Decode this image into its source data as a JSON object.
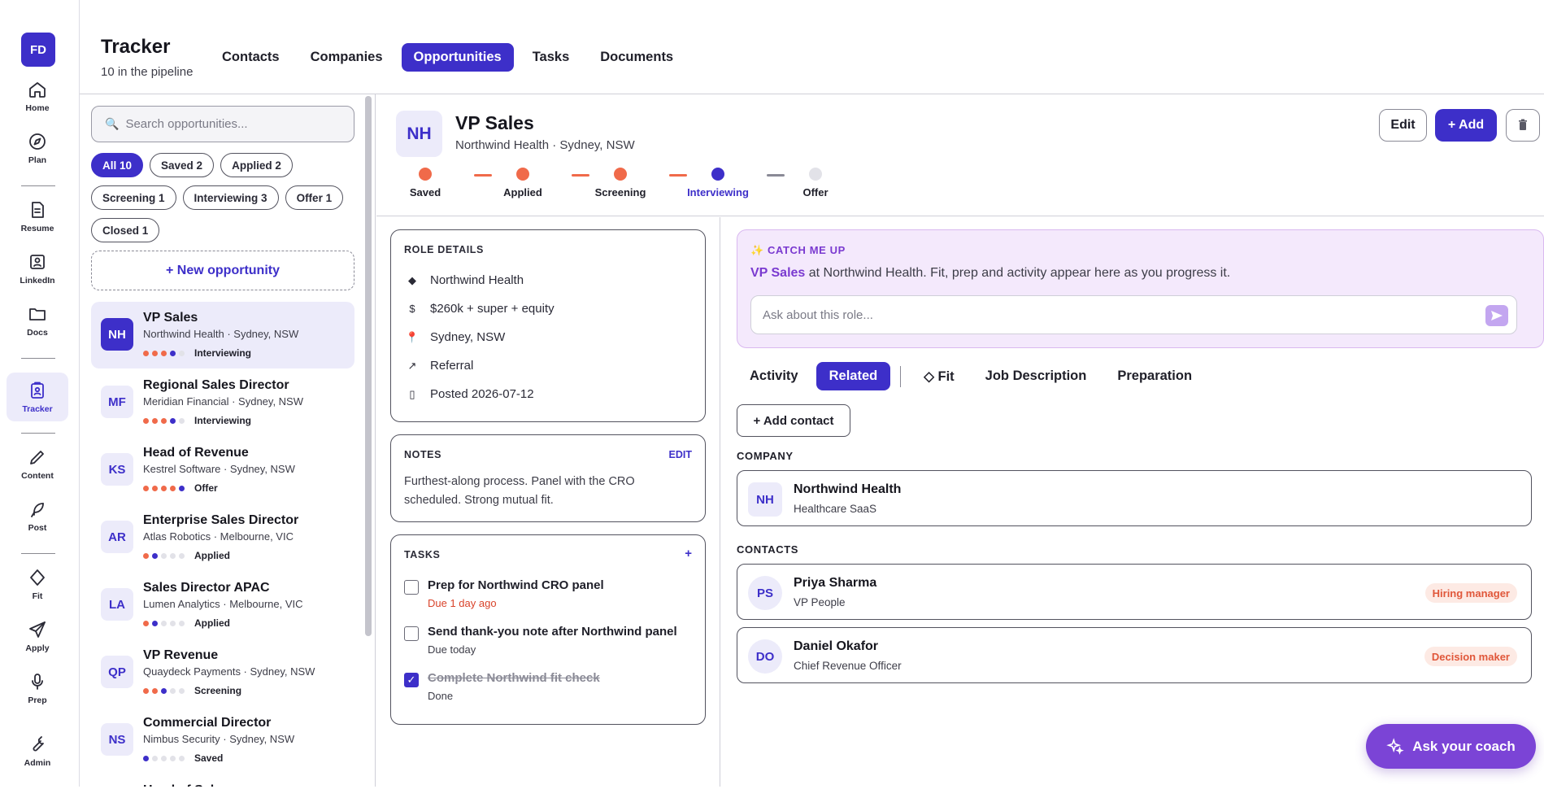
{
  "user": {
    "initials": "FD"
  },
  "nav": [
    {
      "label": "Home",
      "icon": "home-icon"
    },
    {
      "label": "Plan",
      "icon": "compass-icon"
    },
    {
      "label": "Resume",
      "icon": "document-icon"
    },
    {
      "label": "LinkedIn",
      "icon": "profile-card-icon"
    },
    {
      "label": "Docs",
      "icon": "folder-icon"
    },
    {
      "label": "Tracker",
      "icon": "tracker-icon"
    },
    {
      "label": "Content",
      "icon": "pen-icon"
    },
    {
      "label": "Post",
      "icon": "feather-icon"
    },
    {
      "label": "Fit",
      "icon": "diamond-icon"
    },
    {
      "label": "Apply",
      "icon": "send-icon"
    },
    {
      "label": "Prep",
      "icon": "microphone-icon"
    },
    {
      "label": "Admin",
      "icon": "wrench-icon"
    }
  ],
  "header": {
    "title": "Tracker",
    "subtitle": "10 in the pipeline",
    "tabs": [
      "Contacts",
      "Companies",
      "Opportunities",
      "Tasks",
      "Documents"
    ],
    "active_tab": "Opportunities"
  },
  "list": {
    "search_placeholder": "Search opportunities...",
    "filters": [
      "All 10",
      "Saved 2",
      "Applied 2",
      "Screening 1",
      "Interviewing 3",
      "Offer 1",
      "Closed 1"
    ],
    "new_label": "+ New opportunity",
    "items": [
      {
        "initials": "NH",
        "title": "VP Sales",
        "sub": "Northwind Health · Sydney, NSW",
        "stage": "Interviewing",
        "progress": 4
      },
      {
        "initials": "MF",
        "title": "Regional Sales Director",
        "sub": "Meridian Financial · Sydney, NSW",
        "stage": "Interviewing",
        "progress": 4
      },
      {
        "initials": "KS",
        "title": "Head of Revenue",
        "sub": "Kestrel Software · Sydney, NSW",
        "stage": "Offer",
        "progress": 5
      },
      {
        "initials": "AR",
        "title": "Enterprise Sales Director",
        "sub": "Atlas Robotics · Melbourne, VIC",
        "stage": "Applied",
        "progress": 2
      },
      {
        "initials": "LA",
        "title": "Sales Director APAC",
        "sub": "Lumen Analytics · Melbourne, VIC",
        "stage": "Applied",
        "progress": 2
      },
      {
        "initials": "QP",
        "title": "VP Revenue",
        "sub": "Quaydeck Payments · Sydney, NSW",
        "stage": "Screening",
        "progress": 3
      },
      {
        "initials": "NS",
        "title": "Commercial Director",
        "sub": "Nimbus Security · Sydney, NSW",
        "stage": "Saved",
        "progress": 1
      },
      {
        "initials": "",
        "title": "Head of Sal",
        "sub": "",
        "stage": "",
        "progress": 0
      }
    ]
  },
  "detail": {
    "initials": "NH",
    "title": "VP Sales",
    "subtitle": "Northwind Health · Sydney, NSW",
    "edit_label": "Edit",
    "add_label": "+ Add",
    "delete_icon": "trash-icon",
    "stages": [
      "Saved",
      "Applied",
      "Screening",
      "Interviewing",
      "Offer"
    ],
    "current_stage": "Interviewing",
    "role": {
      "heading": "ROLE DETAILS",
      "rows": [
        {
          "icon": "◆",
          "text": "Northwind Health"
        },
        {
          "icon": "$",
          "text": "$260k + super + equity"
        },
        {
          "icon": "📍",
          "text": "Sydney, NSW"
        },
        {
          "icon": "↗",
          "text": "Referral"
        },
        {
          "icon": "▯",
          "text": "Posted 2026-07-12"
        }
      ]
    },
    "notes": {
      "heading": "NOTES",
      "edit": "EDIT",
      "text": "Furthest-along process. Panel with the CRO scheduled. Strong mutual fit."
    },
    "tasks": {
      "heading": "TASKS",
      "add": "+",
      "items": [
        {
          "title": "Prep for Northwind CRO panel",
          "due": "Due 1 day ago",
          "done": false,
          "overdue": true
        },
        {
          "title": "Send thank-you note after Northwind panel",
          "due": "Due today",
          "done": false,
          "overdue": false
        },
        {
          "title": "Complete Northwind fit check",
          "due": "Done",
          "done": true,
          "overdue": false
        }
      ]
    },
    "catch": {
      "heading": "✨ CATCH ME UP",
      "role": "VP Sales",
      "text": " at Northwind Health. Fit, prep and activity appear here as you progress it.",
      "placeholder": "Ask about this role..."
    },
    "tabs": [
      "Activity",
      "Related",
      "◇ Fit",
      "Job Description",
      "Preparation"
    ],
    "active_tab": "Related",
    "add_contact": "+ Add contact",
    "company_heading": "COMPANY",
    "company": {
      "initials": "NH",
      "name": "Northwind Health",
      "sector": "Healthcare SaaS"
    },
    "contacts_heading": "CONTACTS",
    "contacts": [
      {
        "initials": "PS",
        "name": "Priya Sharma",
        "role": "VP People",
        "tag": "Hiring manager"
      },
      {
        "initials": "DO",
        "name": "Daniel Okafor",
        "role": "Chief Revenue Officer",
        "tag": "Decision maker"
      }
    ]
  },
  "coach_label": "Ask your coach",
  "colors": {
    "accent": "#3d2fc9",
    "done": "#f06a4a",
    "coach": "#7b44d6"
  }
}
